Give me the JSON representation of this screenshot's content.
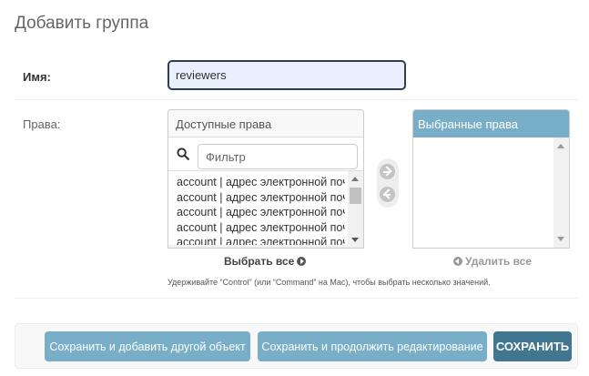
{
  "page": {
    "title": "Добавить группа"
  },
  "name_field": {
    "label": "Имя:",
    "value": "reviewers"
  },
  "permissions": {
    "label": "Права:",
    "available": {
      "title": "Доступные права",
      "filter_placeholder": "Фильтр",
      "items": [
        "account | адрес электронной почты | Can add",
        "account | адрес электронной почты | Can change",
        "account | адрес электронной почты | Can delete",
        "account | адрес электронной почты | Can view",
        "account | адрес электронной почты"
      ],
      "choose_all": "Выбрать все"
    },
    "chosen": {
      "title": "Выбранные права",
      "items": [],
      "remove_all": "Удалить все"
    },
    "help_text": "Удерживайте “Control” (или “Command” на Mac), чтобы выбрать несколько значений."
  },
  "submit": {
    "save_add_another": "Сохранить и добавить другой объект",
    "save_continue": "Сохранить и продолжить редактирование",
    "save": "СОХРАНИТЬ"
  },
  "icons": {
    "search": "search-icon",
    "add": "arrow-right-circle-icon",
    "remove": "arrow-left-circle-icon"
  },
  "colors": {
    "primary": "#79aec8",
    "primary_dark": "#417690",
    "input_focus": "#2c3e50"
  }
}
